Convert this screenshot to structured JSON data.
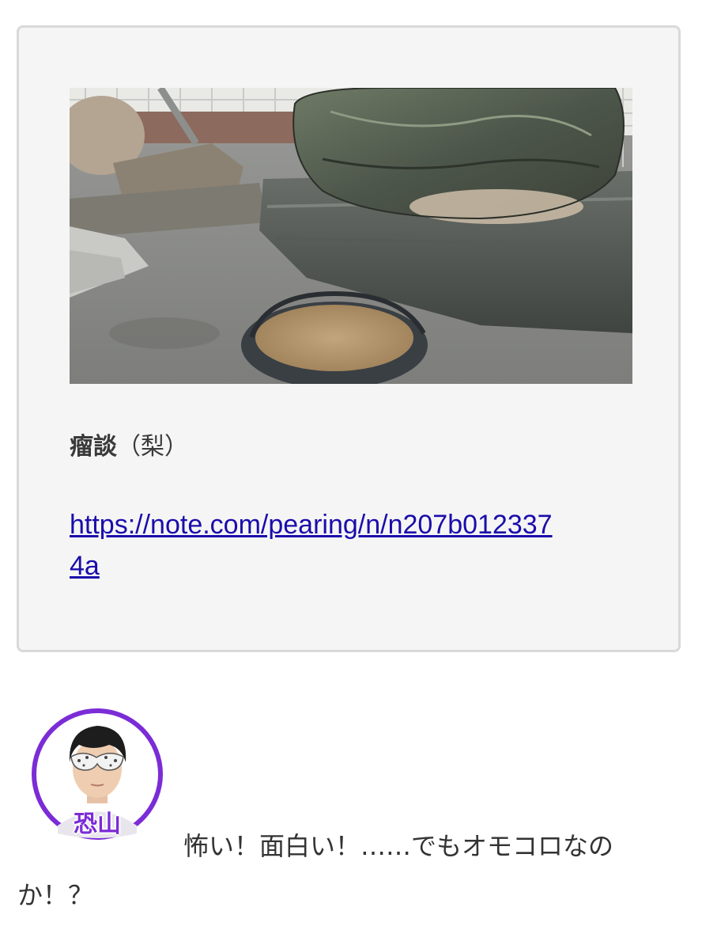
{
  "post": {
    "title_main": "瘤談",
    "title_sub": "（梨）",
    "link_line1": "https://note.com/pearing/n/n207b012337",
    "link_line2": "4a"
  },
  "photo": {
    "icon": "photo-of-stones-and-bonsai-pot"
  },
  "speaker": {
    "name": "恐山",
    "ring_color": "#7b2cd6",
    "name_color": "#7b2cd6"
  },
  "comment": {
    "line1": "怖い！面白い！……でもオモコロなの",
    "line2": "か！？"
  }
}
